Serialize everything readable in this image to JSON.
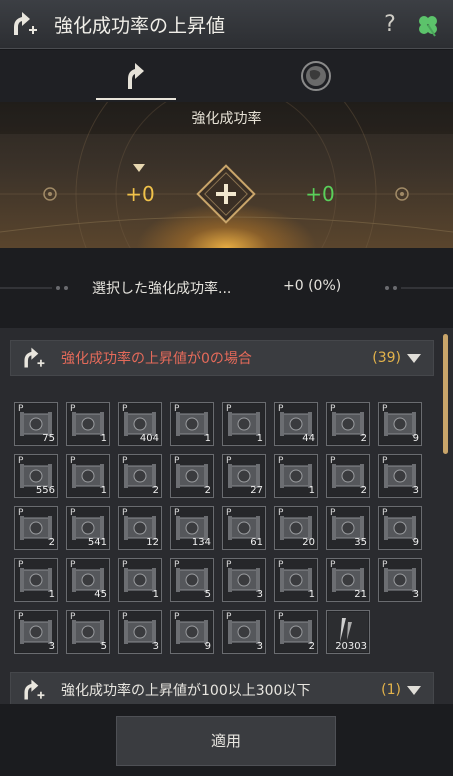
{
  "window": {
    "title": "強化成功率の上昇値",
    "help_label": "?",
    "title_icon": "upgrade-arrow-icon",
    "clover_icon": "clover-icon"
  },
  "tabs": [
    {
      "icon": "upgrade-arrow-icon",
      "active": true
    },
    {
      "icon": "globe-icon",
      "active": false
    }
  ],
  "hero": {
    "label": "強化成功率",
    "left_value": "+0",
    "right_value": "+0",
    "left_color": "#f0c24a",
    "right_color": "#5ad05a"
  },
  "summary": {
    "label": "選択した強化成功率...",
    "value": "+0 (0%)"
  },
  "groups": [
    {
      "title": "強化成功率の上昇値が0の場合",
      "count": "(39)",
      "title_color": "#e46a5a",
      "items": [
        "75",
        "1",
        "404",
        "1",
        "1",
        "44",
        "2",
        "9",
        "556",
        "1",
        "2",
        "2",
        "27",
        "1",
        "2",
        "3",
        "2",
        "541",
        "12",
        "134",
        "61",
        "20",
        "35",
        "9",
        "1",
        "45",
        "1",
        "5",
        "3",
        "1",
        "21",
        "3",
        "3",
        "5",
        "3",
        "9",
        "3",
        "2",
        "20303"
      ]
    },
    {
      "title": "強化成功率の上昇値が100以上300以下",
      "count": "(1)",
      "title_color": "#e8e6e0"
    }
  ],
  "slot_p_label": "P",
  "footer": {
    "apply_label": "適用"
  }
}
